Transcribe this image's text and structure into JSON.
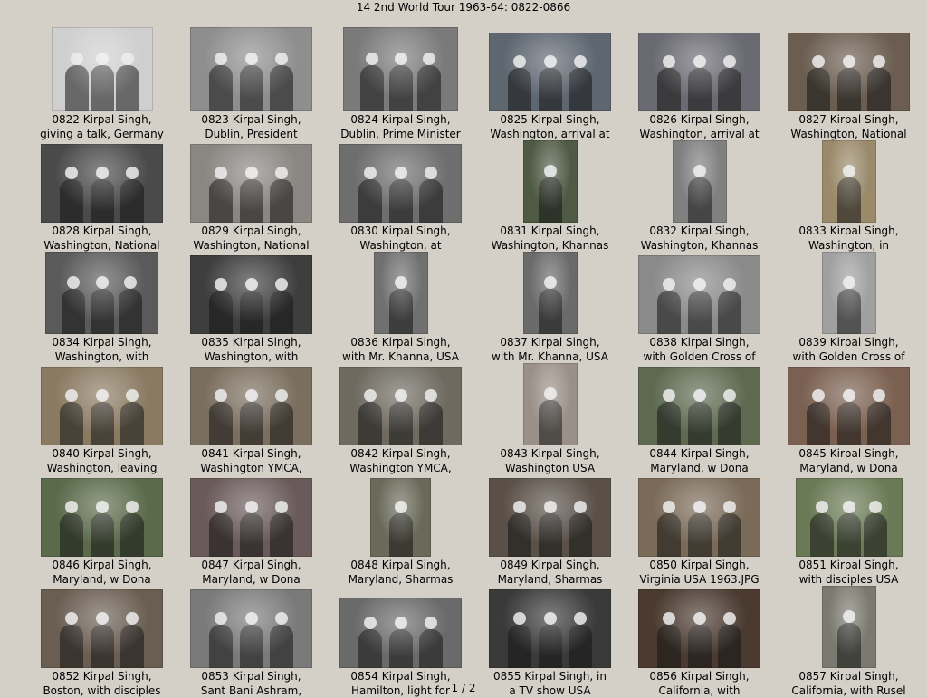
{
  "title": "14 2nd World Tour 1963-64: 0822-0866",
  "page_indicator": "1 / 2",
  "thumbnails": [
    {
      "l1": "0822  Kirpal Singh,",
      "l2": "giving a talk, Germany",
      "tone": "#cfcfcf"
    },
    {
      "l1": "0823  Kirpal Singh,",
      "l2": "Dublin, President",
      "tone": "#8e8e8e"
    },
    {
      "l1": "0824  Kirpal Singh,",
      "l2": "Dublin, Prime Minister",
      "tone": "#7a7a7a"
    },
    {
      "l1": "0825  Kirpal Singh,",
      "l2": "Washington, arrival at",
      "tone": "#5e6670"
    },
    {
      "l1": "0826  Kirpal Singh,",
      "l2": "Washington, arrival at",
      "tone": "#6a6a72"
    },
    {
      "l1": "0827  Kirpal Singh,",
      "l2": "Washington, National",
      "tone": "#6b5d50"
    },
    {
      "l1": "0828  Kirpal Singh,",
      "l2": "Washington, National",
      "tone": "#4a4a4a"
    },
    {
      "l1": "0829  Kirpal Singh,",
      "l2": "Washington, National",
      "tone": "#8a8682"
    },
    {
      "l1": "0830  Kirpal Singh,",
      "l2": "Washington, at",
      "tone": "#6e6e6e"
    },
    {
      "l1": "0831  Kirpal Singh,",
      "l2": "Washington, Khannas",
      "tone": "#4e5a44"
    },
    {
      "l1": "0832  Kirpal Singh,",
      "l2": "Washington, Khannas",
      "tone": "#808080"
    },
    {
      "l1": "0833  Kirpal Singh,",
      "l2": "Washington, in",
      "tone": "#9a8a6a"
    },
    {
      "l1": "0834  Kirpal Singh,",
      "l2": "Washington, with",
      "tone": "#5a5a5a"
    },
    {
      "l1": "0835  Kirpal Singh,",
      "l2": "Washington, with",
      "tone": "#3e3e3e"
    },
    {
      "l1": "0836  Kirpal Singh,",
      "l2": "with Mr. Khanna, USA",
      "tone": "#707070"
    },
    {
      "l1": "0837  Kirpal Singh,",
      "l2": "with Mr. Khanna, USA",
      "tone": "#6a6a6a"
    },
    {
      "l1": "0838  Kirpal Singh,",
      "l2": "with Golden Cross of",
      "tone": "#8a8a8a"
    },
    {
      "l1": "0839  Kirpal Singh,",
      "l2": "with Golden Cross of",
      "tone": "#a0a0a0"
    },
    {
      "l1": "0840  Kirpal Singh,",
      "l2": "Washington, leaving",
      "tone": "#8a7a62"
    },
    {
      "l1": "0841  Kirpal Singh,",
      "l2": "Washington YMCA,",
      "tone": "#7a6e5e"
    },
    {
      "l1": "0842  Kirpal Singh,",
      "l2": "Washington YMCA,",
      "tone": "#6e6a60"
    },
    {
      "l1": "0843  Kirpal Singh,",
      "l2": "Washington USA",
      "tone": "#9a9088"
    },
    {
      "l1": "0844  Kirpal Singh,",
      "l2": "Maryland, w Dona",
      "tone": "#5e6a50"
    },
    {
      "l1": "0845  Kirpal Singh,",
      "l2": "Maryland, w Dona",
      "tone": "#7a6050"
    },
    {
      "l1": "0846  Kirpal Singh,",
      "l2": "Maryland, w Dona",
      "tone": "#5a6a4a"
    },
    {
      "l1": "0847  Kirpal Singh,",
      "l2": "Maryland, w Dona",
      "tone": "#6a5a5a"
    },
    {
      "l1": "0848  Kirpal Singh,",
      "l2": "Maryland, Sharmas",
      "tone": "#6a6a5a"
    },
    {
      "l1": "0849  Kirpal Singh,",
      "l2": "Maryland, Sharmas",
      "tone": "#5a5048"
    },
    {
      "l1": "0850  Kirpal Singh,",
      "l2": "Virginia USA 1963.JPG",
      "tone": "#7a6a58"
    },
    {
      "l1": "0851  Kirpal Singh,",
      "l2": "with disciples USA",
      "tone": "#6a7a56"
    },
    {
      "l1": "0852  Kirpal Singh,",
      "l2": "Boston, with disciples",
      "tone": "#6a5e52"
    },
    {
      "l1": "0853  Kirpal Singh,",
      "l2": "Sant Bani Ashram,",
      "tone": "#7a7a7a"
    },
    {
      "l1": "0854  Kirpal Singh,",
      "l2": "Hamilton, light for",
      "tone": "#6a6a6a"
    },
    {
      "l1": "0855  Kirpal Singh, in",
      "l2": "a TV show USA",
      "tone": "#3a3a3a"
    },
    {
      "l1": "0856  Kirpal Singh,",
      "l2": "California, with",
      "tone": "#4a3a30"
    },
    {
      "l1": "0857  Kirpal Singh,",
      "l2": "California, with Rusel",
      "tone": "#7a7a70"
    }
  ]
}
